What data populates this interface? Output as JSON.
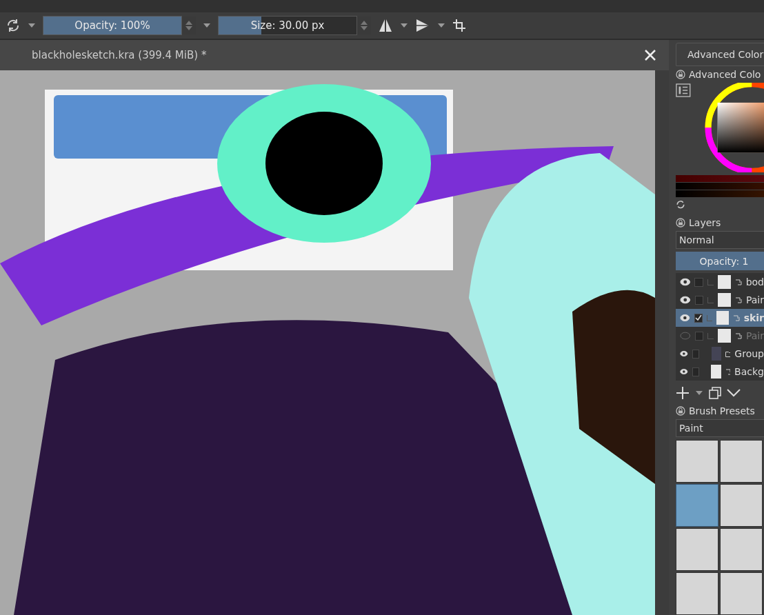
{
  "toolbar": {
    "opacity": {
      "label": "Opacity: 100%",
      "level": 1
    },
    "size": {
      "label": "Size: 30.00 px",
      "level": 0.31
    }
  },
  "document": {
    "title": "blackholesketch.kra (399.4 MiB) *"
  },
  "color_panel": {
    "tab": "Advanced Color",
    "title": "Advanced Colo"
  },
  "layers_panel": {
    "title": "Layers",
    "blend_mode": "Normal",
    "opacity": {
      "label": "Opacity: 1",
      "level": 1
    },
    "layers": [
      {
        "name": "bod",
        "kind": "paint",
        "nested": true,
        "visible": true,
        "checked": false,
        "selected": false
      },
      {
        "name": "Pair",
        "kind": "paint",
        "nested": true,
        "visible": true,
        "checked": false,
        "selected": false
      },
      {
        "name": "skir",
        "kind": "paint",
        "nested": true,
        "visible": true,
        "checked": true,
        "selected": true
      },
      {
        "name": "Pair",
        "kind": "paint",
        "nested": true,
        "visible": false,
        "checked": false,
        "selected": false
      },
      {
        "name": "Group",
        "kind": "group",
        "nested": false,
        "visible": true,
        "checked": false,
        "selected": false
      },
      {
        "name": "Backg",
        "kind": "paint",
        "nested": false,
        "visible": true,
        "checked": false,
        "selected": false
      }
    ]
  },
  "brush_panel": {
    "title": "Brush Presets",
    "tag": "Paint",
    "presets": [
      {
        "selected": false
      },
      {
        "selected": false
      },
      {
        "selected": true
      },
      {
        "selected": false
      },
      {
        "selected": false
      },
      {
        "selected": false
      },
      {
        "selected": false
      },
      {
        "selected": false
      }
    ]
  }
}
